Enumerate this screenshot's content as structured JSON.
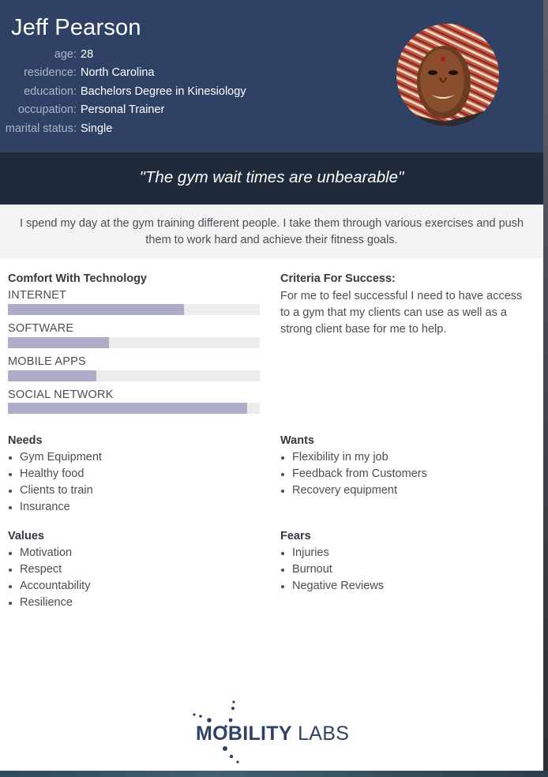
{
  "persona": {
    "name": "Jeff Pearson",
    "details": [
      {
        "label": "age:",
        "value": "28"
      },
      {
        "label": "residence:",
        "value": "North Carolina"
      },
      {
        "label": "education:",
        "value": "Bachelors Degree in Kinesiology"
      },
      {
        "label": "occupation:",
        "value": "Personal Trainer"
      },
      {
        "label": "marital status:",
        "value": "Single"
      }
    ],
    "quote": "\"The gym wait times are unbearable\"",
    "bio": "I spend my day at the gym training different people. I take them through various exercises and push them to work hard and achieve their fitness goals."
  },
  "comfort": {
    "title": "Comfort With Technology",
    "skills": [
      {
        "label": "INTERNET",
        "level": 0.7
      },
      {
        "label": "SOFTWARE",
        "level": 0.4
      },
      {
        "label": "MOBILE APPS",
        "level": 0.35
      },
      {
        "label": "SOCIAL NETWORK",
        "level": 0.95
      }
    ]
  },
  "criteria": {
    "title": "Criteria For Success:",
    "text": "For me to feel successful I need to have access to a gym that my clients can use as well as a strong client base for me to help."
  },
  "needs": {
    "title": "Needs",
    "items": [
      "Gym Equipment",
      "Healthy food",
      "Clients to train",
      "Insurance"
    ]
  },
  "wants": {
    "title": "Wants",
    "items": [
      "Flexibility in my job",
      "Feedback from Customers",
      "Recovery equipment"
    ]
  },
  "values": {
    "title": "Values",
    "items": [
      "Motivation",
      "Respect",
      "Accountability",
      "Resilience"
    ]
  },
  "fears": {
    "title": "Fears",
    "items": [
      "Injuries",
      "Burnout",
      "Negative Reviews"
    ]
  },
  "logo": {
    "text_bold": "MOBILITY",
    "text_light": " LABS"
  },
  "colors": {
    "header": "#2f4266",
    "quote_band": "#1f2b3b",
    "bar_fill": "#adadc9",
    "bar_track": "#ececec"
  }
}
